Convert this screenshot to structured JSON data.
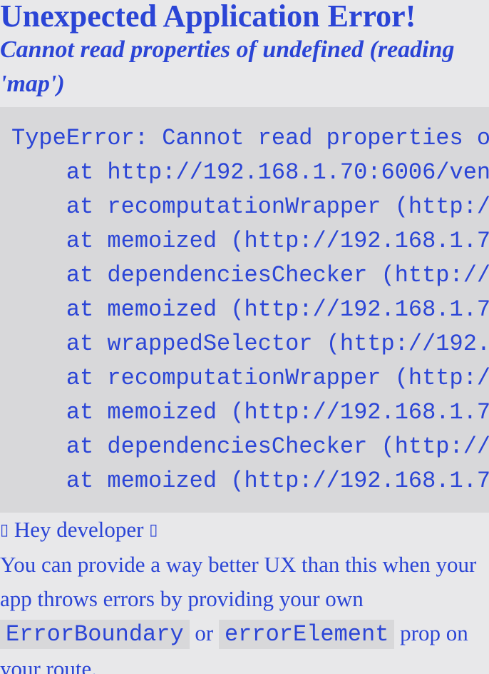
{
  "error": {
    "title": "Unexpected Application Error!",
    "message": "Cannot read properties of undefined (reading 'map')",
    "stack_lines": [
      "TypeError: Cannot read properties o",
      "    at http://192.168.1.70:6006/ven",
      "    at recomputationWrapper (http:/",
      "    at memoized (http://192.168.1.7",
      "    at dependenciesChecker (http://",
      "    at memoized (http://192.168.1.7",
      "    at wrappedSelector (http://192.",
      "    at recomputationWrapper (http:/",
      "    at memoized (http://192.168.1.7",
      "    at dependenciesChecker (http://",
      "    at memoized (http://192.168.1.7"
    ]
  },
  "developer_hint": {
    "glyph_left": "▯",
    "heading": " Hey developer ",
    "glyph_right": "▯",
    "text_before": "You can provide a way better UX than this when your app throws errors by providing your own ",
    "code_1": "ErrorBoundary",
    "text_between": " or ",
    "code_2": "errorElement",
    "text_after": " prop on your route."
  }
}
